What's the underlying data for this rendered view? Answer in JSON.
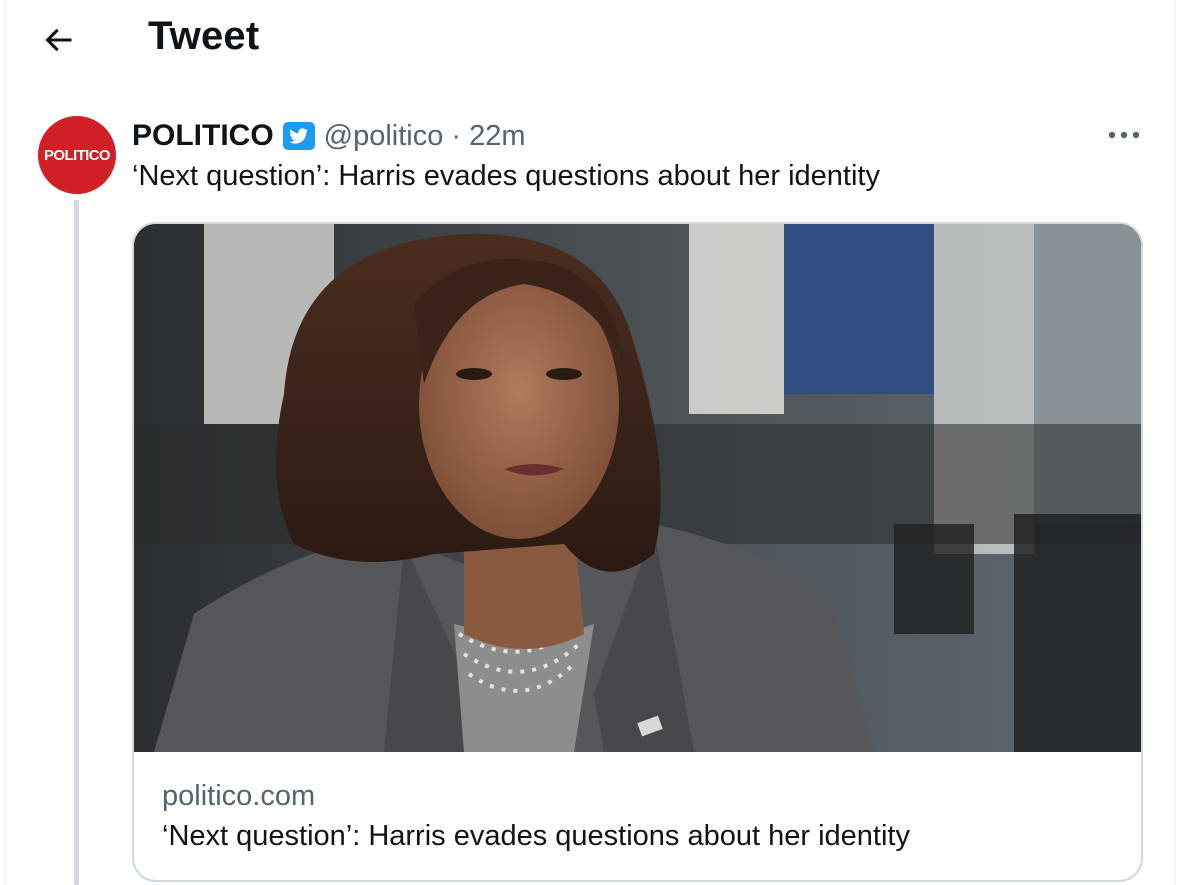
{
  "header": {
    "title": "Tweet",
    "back_icon": "arrow-left-icon"
  },
  "tweet": {
    "avatar_text": "POLITICO",
    "avatar_color": "#d02025",
    "display_name": "POLITICO",
    "verified_icon": "verified-badge-icon",
    "verified_color": "#1d9bf0",
    "handle": "@politico",
    "separator": "·",
    "timestamp": "22m",
    "more_icon": "more-options-icon",
    "text": "‘Next question’: Harris evades questions about her identity",
    "card": {
      "image_alt": "Woman in gray blazer with pearl necklace speaking in an interview",
      "domain": "politico.com",
      "title": "‘Next question’: Harris evades questions about her identity"
    }
  }
}
